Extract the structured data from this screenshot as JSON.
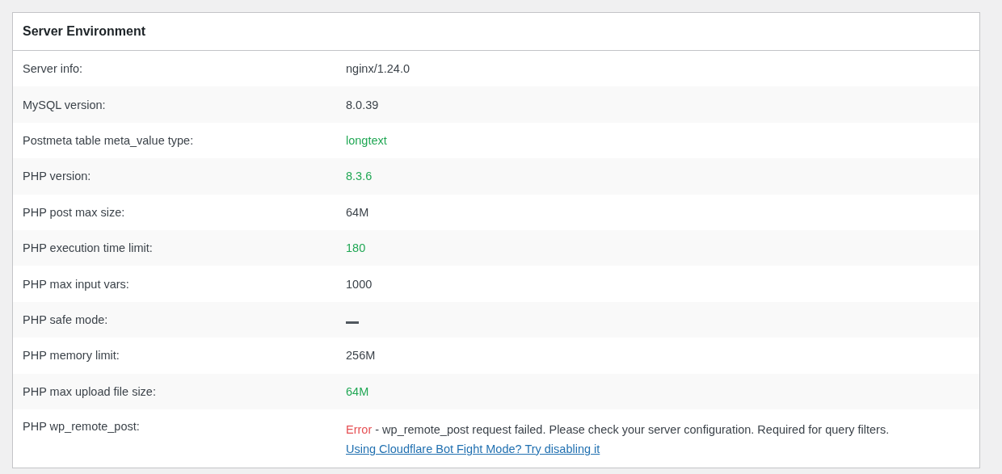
{
  "panel": {
    "title": "Server Environment",
    "rows": [
      {
        "label": "Server info:",
        "kind": "text",
        "value": "nginx/1.24.0",
        "color": "#3c434a"
      },
      {
        "label": "MySQL version:",
        "kind": "text",
        "value": "8.0.39",
        "color": "#3c434a"
      },
      {
        "label": "Postmeta table meta_value type:",
        "kind": "text",
        "value": "longtext",
        "color": "#20a754"
      },
      {
        "label": "PHP version:",
        "kind": "text",
        "value": "8.3.6",
        "color": "#20a754"
      },
      {
        "label": "PHP post max size:",
        "kind": "text",
        "value": "64M",
        "color": "#3c434a"
      },
      {
        "label": "PHP execution time limit:",
        "kind": "text",
        "value": "180",
        "color": "#20a754"
      },
      {
        "label": "PHP max input vars:",
        "kind": "text",
        "value": "1000",
        "color": "#3c434a"
      },
      {
        "label": "PHP safe mode:",
        "kind": "dash"
      },
      {
        "label": "PHP memory limit:",
        "kind": "text",
        "value": "256M",
        "color": "#3c434a"
      },
      {
        "label": "PHP max upload file size:",
        "kind": "text",
        "value": "64M",
        "color": "#20a754"
      },
      {
        "label": "PHP wp_remote_post:",
        "kind": "error",
        "error_label": "Error",
        "message": " - wp_remote_post request failed. Please check your server configuration. Required for query filters.",
        "link": "Using Cloudflare Bot Fight Mode? Try disabling it"
      }
    ]
  }
}
